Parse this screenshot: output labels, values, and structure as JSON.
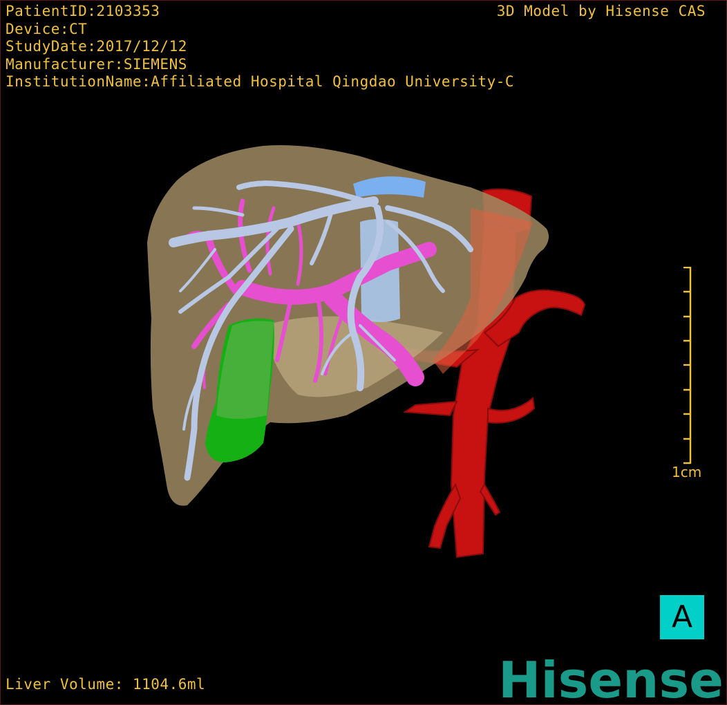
{
  "meta": {
    "patient_id": "PatientID:2103353",
    "device": "Device:CT",
    "study_date": "StudyDate:2017/12/12",
    "manufacturer": "Manufacturer:SIEMENS",
    "institution": "InstitutionName:Affiliated Hospital Qingdao University-C"
  },
  "credit": "3D Model by Hisense CAS",
  "liver_volume": "Liver Volume: 1104.6ml",
  "scale": {
    "label": "1cm"
  },
  "orientation": {
    "label": "A"
  },
  "logo": {
    "text": "Hisense"
  },
  "colors": {
    "overlay_text": "#f0c040",
    "liver": "#a08a62",
    "hepatic_vein": "#b8c8e4",
    "portal_vein": "#e64fd0",
    "artery": "#c81212",
    "gallbladder": "#14b014",
    "ivc": "#a8c8ec",
    "orientation_bg": "#00d0c8",
    "logo": "#1a9a88"
  }
}
